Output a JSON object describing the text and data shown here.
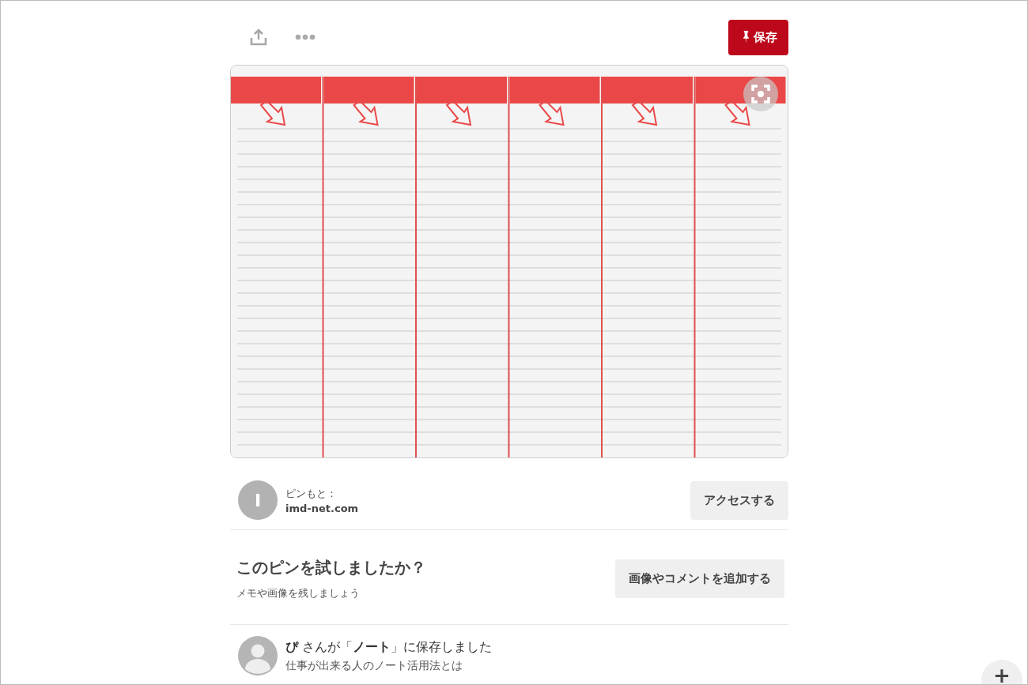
{
  "toolbar": {
    "save_button": "保存"
  },
  "source": {
    "avatar_letter": "I",
    "label": "ピンもと：",
    "domain": "imd-net.com",
    "button": "アクセスする"
  },
  "tried": {
    "title": "このピンを試しましたか？",
    "subtitle": "メモや画像を残しましょう",
    "button": "画像やコメントを追加する"
  },
  "saved": {
    "text": "**ぴ** さんが「**ノート**」に保存しました",
    "description": "仕事が出来る人のノート活用法とは"
  },
  "fab": {
    "label": "+"
  }
}
